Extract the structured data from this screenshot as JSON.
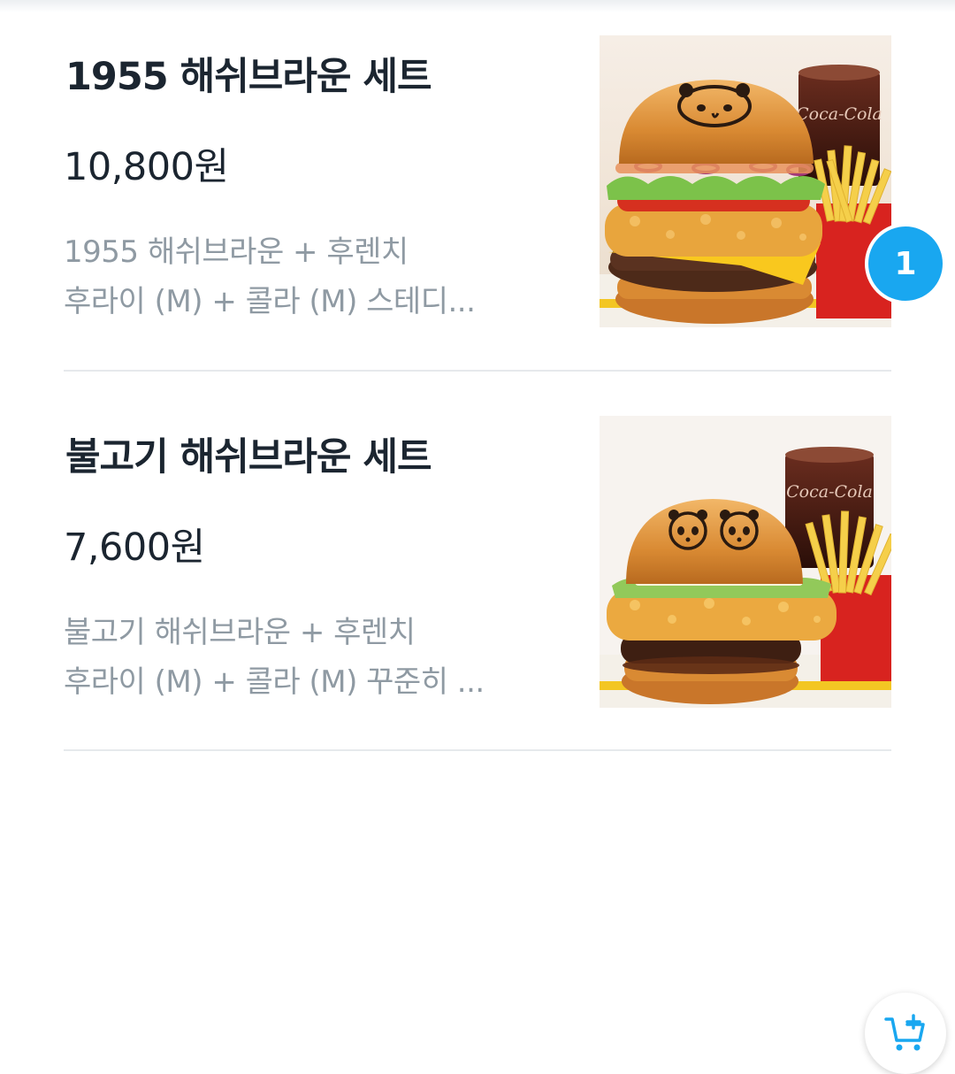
{
  "items": [
    {
      "title": "1955 해쉬브라운 세트",
      "price": "10,800원",
      "description_line1": "1955 해쉬브라운 + 후렌치",
      "description_line2": "후라이 (M) + 콜라 (M) 스테디...",
      "image_alt": "1955 해쉬브라운 세트 이미지",
      "cart_count": "1",
      "drink_logo": "Coca-Cola"
    },
    {
      "title": "불고기 해쉬브라운 세트",
      "price": "7,600원",
      "description_line1": "불고기 해쉬브라운 + 후렌치",
      "description_line2": "후라이 (M) + 콜라 (M) 꾸준히 ...",
      "image_alt": "불고기 해쉬브라운 세트 이미지",
      "cart_action_icon": "add-to-cart-icon",
      "drink_logo": "Coca-Cola"
    }
  ],
  "colors": {
    "title": "#1b2530",
    "description": "#8f9aa3",
    "badge": "#19a7f0",
    "separator": "#e6e9ec"
  }
}
